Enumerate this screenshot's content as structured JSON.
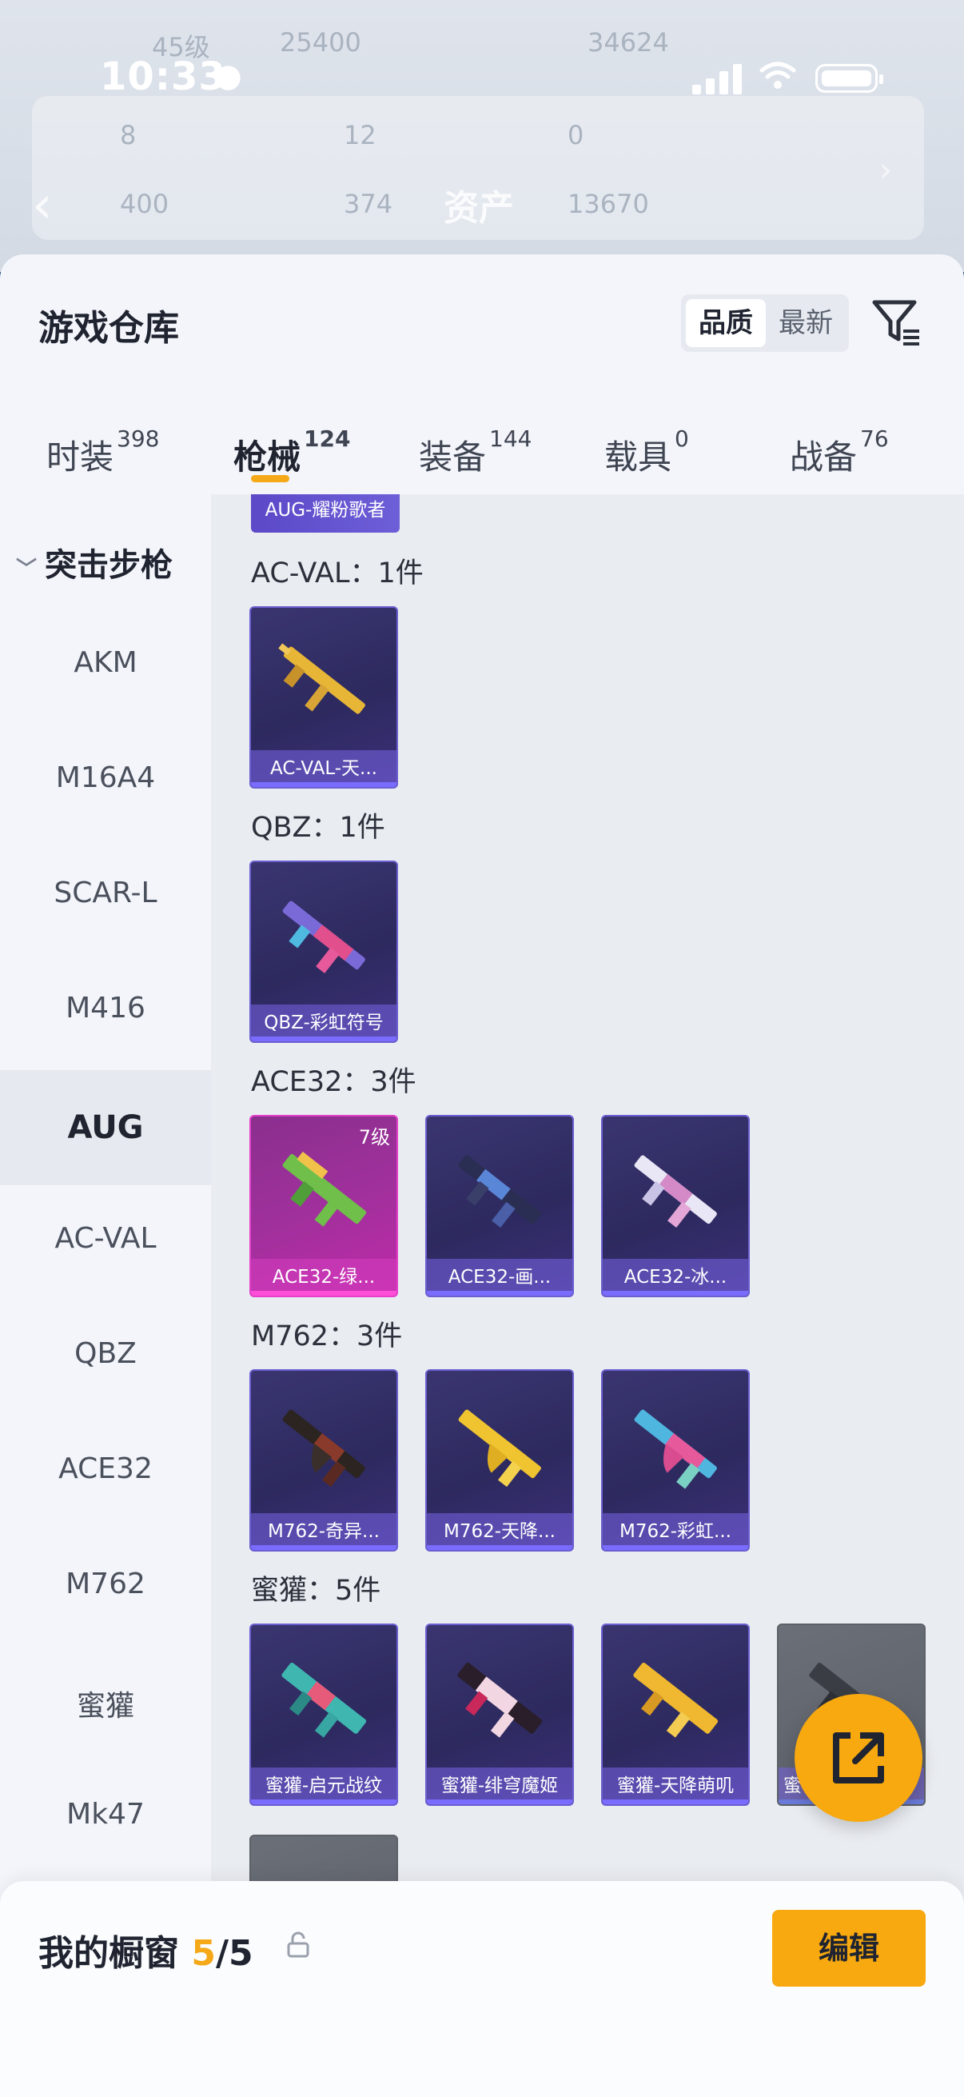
{
  "background": {
    "stats_row1": [
      "45级",
      "25400",
      "34624"
    ],
    "stats_row2": [
      "8",
      "12",
      "0"
    ],
    "stats_row3": [
      "400",
      "374",
      "13670"
    ],
    "title": "资产"
  },
  "status_bar": {
    "time": "10:33"
  },
  "sheet": {
    "title": "游戏仓库",
    "sort": {
      "options": [
        "品质",
        "最新"
      ],
      "selected": "品质"
    },
    "filter_icon": "filter-icon",
    "tabs": [
      {
        "label": "时装",
        "count": "398"
      },
      {
        "label": "枪械",
        "count": "124",
        "active": true
      },
      {
        "label": "装备",
        "count": "144"
      },
      {
        "label": "载具",
        "count": "0"
      },
      {
        "label": "战备",
        "count": "76"
      }
    ]
  },
  "categories": {
    "header": "突击步枪",
    "items": [
      "AKM",
      "M16A4",
      "SCAR-L",
      "M416",
      "AUG",
      "AC-VAL",
      "QBZ",
      "ACE32",
      "M762",
      "蜜獾",
      "Mk47"
    ],
    "selected": "AUG"
  },
  "content": {
    "partial_top_label": "AUG-耀粉歌者",
    "groups": [
      {
        "title": "AC-VAL：1件",
        "items": [
          {
            "label": "AC-VAL-天...",
            "style": "normal"
          }
        ]
      },
      {
        "title": "QBZ：1件",
        "items": [
          {
            "label": "QBZ-彩虹符号",
            "style": "normal"
          }
        ]
      },
      {
        "title": "ACE32：3件",
        "items": [
          {
            "label": "ACE32-绿...",
            "style": "pink",
            "level": "7级"
          },
          {
            "label": "ACE32-画...",
            "style": "normal"
          },
          {
            "label": "ACE32-冰...",
            "style": "normal"
          }
        ]
      },
      {
        "title": "M762：3件",
        "items": [
          {
            "label": "M762-奇异...",
            "style": "normal"
          },
          {
            "label": "M762-天降...",
            "style": "normal"
          },
          {
            "label": "M762-彩虹...",
            "style": "normal"
          }
        ]
      },
      {
        "title": "蜜獾：5件",
        "items": [
          {
            "label": "蜜獾-启元战纹",
            "style": "normal"
          },
          {
            "label": "蜜獾-绯穹魔姬",
            "style": "normal"
          },
          {
            "label": "蜜獾-天降萌叽",
            "style": "normal"
          },
          {
            "label": "蜜",
            "style": "grey"
          }
        ]
      }
    ]
  },
  "bottom_bar": {
    "label": "我的橱窗",
    "current": "5",
    "total": "/5",
    "edit_label": "编辑"
  },
  "colors": {
    "accent": "#f7a90f",
    "card_purple": "#2d2a5f",
    "card_pink": "#a0309c"
  }
}
